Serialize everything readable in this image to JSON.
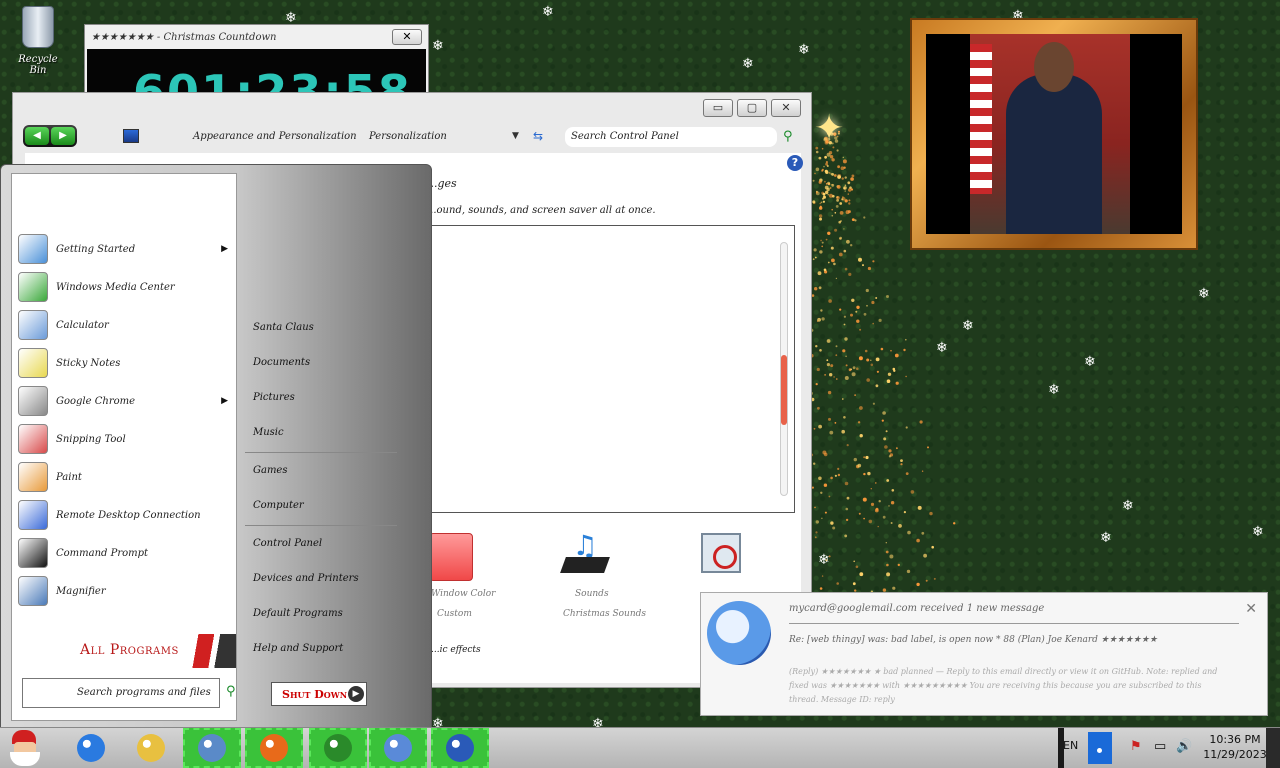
{
  "desktop": {
    "recycle_bin_label": "Recycle Bin"
  },
  "gadget": {
    "title": "★★★★★★★ - Christmas Countdown",
    "close": "✕",
    "countdown": "601:23:58"
  },
  "window": {
    "caption_buttons": [
      "▭",
      "▢",
      "✕"
    ],
    "nav_back": "◀",
    "nav_fwd": "▶",
    "breadcrumb": [
      "Appearance and Personalization",
      "Personalization"
    ],
    "dropdown_arrow": "▼",
    "refresh": "⇆",
    "search_placeholder": "Search Control Panel",
    "search_icon": "⚲",
    "help": "?",
    "heading": "...ges",
    "description": "...ound, sounds, and screen saver all at once.",
    "color_label_1": "Window Color",
    "color_label_2": "Custom",
    "sounds_label_1": "Sounds",
    "sounds_label_2": "Christmas Sounds",
    "bottom_note": "...ic effects"
  },
  "start_menu": {
    "programs": [
      {
        "label": "Getting Started",
        "has_submenu": true,
        "color": "#4a90d8"
      },
      {
        "label": "Windows Media Center",
        "has_submenu": false,
        "color": "#3aa83a"
      },
      {
        "label": "Calculator",
        "has_submenu": false,
        "color": "#6a9ad8"
      },
      {
        "label": "Sticky Notes",
        "has_submenu": false,
        "color": "#e8d850"
      },
      {
        "label": "Google Chrome",
        "has_submenu": true,
        "color": "#888888"
      },
      {
        "label": "Snipping Tool",
        "has_submenu": false,
        "color": "#d84a4a"
      },
      {
        "label": "Paint",
        "has_submenu": false,
        "color": "#e89a3a"
      },
      {
        "label": "Remote Desktop Connection",
        "has_submenu": false,
        "color": "#3a6ad8"
      },
      {
        "label": "Command Prompt",
        "has_submenu": false,
        "color": "#111111"
      },
      {
        "label": "Magnifier",
        "has_submenu": false,
        "color": "#4a7ab8"
      }
    ],
    "submenu_arrow": "▶",
    "all_programs": "All Programs",
    "search_placeholder": "Search programs and files",
    "search_icon": "⚲",
    "right_links": [
      "Santa Claus",
      "Documents",
      "Pictures",
      "Music",
      "Games",
      "Computer",
      "Control Panel",
      "Devices and Printers",
      "Default Programs",
      "Help and Support"
    ],
    "shutdown": "Shut Down",
    "shutdown_arrow": "▶"
  },
  "notification": {
    "from": "mycard@googlemail.com received 1 new message",
    "subject": "Re: [web thingy] was: bad label, is open now * 88 (Plan)      Joe Kenard ★★★★★★★",
    "preview": "(Reply) ★★★★★★★ ★ bad planned — Reply to this email directly or view it on GitHub. Note: replied and fixed was ★★★★★★★ with ★★★★★★★★★ You are receiving this because you are subscribed to this thread. Message ID: reply",
    "close": "✕"
  },
  "taskbar": {
    "apps": [
      {
        "name": "internet-explorer",
        "active": false
      },
      {
        "name": "file-explorer",
        "active": false
      },
      {
        "name": "chrome",
        "active": true
      },
      {
        "name": "firefox",
        "active": true
      },
      {
        "name": "christmas-tree",
        "active": true
      },
      {
        "name": "control-panel",
        "active": true
      },
      {
        "name": "thunderbird",
        "active": true
      }
    ],
    "language": "EN",
    "tray_icons": [
      "⚑",
      "▭",
      "🔊"
    ],
    "time": "10:36 PM",
    "date": "11/29/2023"
  }
}
